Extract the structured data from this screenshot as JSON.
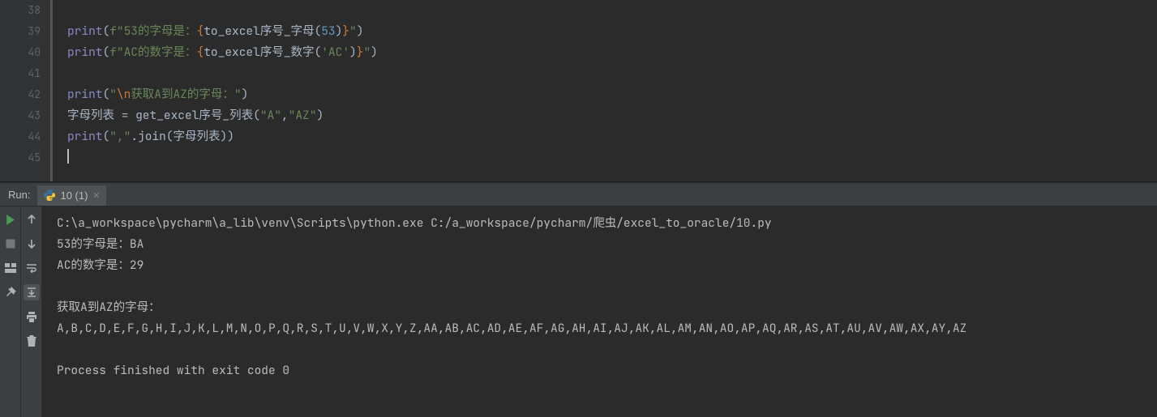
{
  "gutter": {
    "start": 38,
    "end": 45
  },
  "code": [
    {
      "indent": "",
      "tokens": []
    },
    {
      "indent": "",
      "tokens": [
        {
          "cls": "fn",
          "t": "print"
        },
        {
          "cls": "txt",
          "t": "("
        },
        {
          "cls": "str",
          "t": "f\"53的字母是："
        },
        {
          "cls": "braces",
          "t": "{"
        },
        {
          "cls": "txt",
          "t": "to_excel序号_字母("
        },
        {
          "cls": "num",
          "t": "53"
        },
        {
          "cls": "txt",
          "t": ")"
        },
        {
          "cls": "braces",
          "t": "}"
        },
        {
          "cls": "str",
          "t": "\""
        },
        {
          "cls": "txt",
          "t": ")"
        }
      ]
    },
    {
      "indent": "",
      "tokens": [
        {
          "cls": "fn",
          "t": "print"
        },
        {
          "cls": "txt",
          "t": "("
        },
        {
          "cls": "str",
          "t": "f\"AC的数字是："
        },
        {
          "cls": "braces",
          "t": "{"
        },
        {
          "cls": "txt",
          "t": "to_excel序号_数字("
        },
        {
          "cls": "str",
          "t": "'AC'"
        },
        {
          "cls": "txt",
          "t": ")"
        },
        {
          "cls": "braces",
          "t": "}"
        },
        {
          "cls": "str",
          "t": "\""
        },
        {
          "cls": "txt",
          "t": ")"
        }
      ]
    },
    {
      "indent": "",
      "tokens": []
    },
    {
      "indent": "",
      "tokens": [
        {
          "cls": "fn",
          "t": "print"
        },
        {
          "cls": "txt",
          "t": "("
        },
        {
          "cls": "str",
          "t": "\""
        },
        {
          "cls": "kw",
          "t": "\\n"
        },
        {
          "cls": "str",
          "t": "获取A到AZ的字母：\""
        },
        {
          "cls": "txt",
          "t": ")"
        }
      ]
    },
    {
      "indent": "",
      "tokens": [
        {
          "cls": "txt",
          "t": "字母列表 = get_excel序号_列表("
        },
        {
          "cls": "str",
          "t": "\"A\""
        },
        {
          "cls": "txt",
          "t": ","
        },
        {
          "cls": "str",
          "t": "\"AZ\""
        },
        {
          "cls": "txt",
          "t": ")"
        }
      ]
    },
    {
      "indent": "",
      "tokens": [
        {
          "cls": "fn",
          "t": "print"
        },
        {
          "cls": "txt",
          "t": "("
        },
        {
          "cls": "str",
          "t": "\",\""
        },
        {
          "cls": "txt",
          "t": ".join(字母列表))"
        }
      ]
    },
    {
      "indent": "",
      "tokens": [],
      "caret": true
    }
  ],
  "run": {
    "label": "Run:",
    "tab_name": "10 (1)",
    "lines": [
      "C:\\a_workspace\\pycharm\\a_lib\\venv\\Scripts\\python.exe C:/a_workspace/pycharm/爬虫/excel_to_oracle/10.py",
      "53的字母是：BA",
      "AC的数字是：29",
      "",
      "获取A到AZ的字母：",
      "A,B,C,D,E,F,G,H,I,J,K,L,M,N,O,P,Q,R,S,T,U,V,W,X,Y,Z,AA,AB,AC,AD,AE,AF,AG,AH,AI,AJ,AK,AL,AM,AN,AO,AP,AQ,AR,AS,AT,AU,AV,AW,AX,AY,AZ",
      "",
      "Process finished with exit code 0"
    ]
  },
  "icons": {
    "play": "play-icon",
    "stop": "stop-icon",
    "layout": "layout-icon",
    "pin": "pin-icon",
    "up": "up-arrow-icon",
    "down": "down-arrow-icon",
    "softwrap": "softwrap-icon",
    "scroll": "scroll-to-end-icon",
    "print": "print-icon",
    "trash": "trash-icon"
  }
}
